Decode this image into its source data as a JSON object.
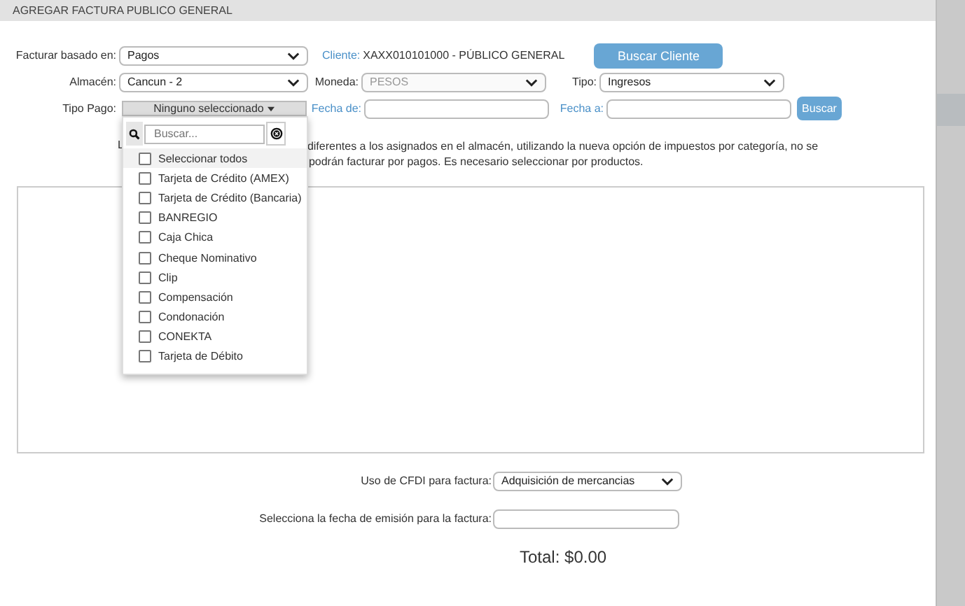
{
  "window": {
    "title": "AGREGAR FACTURA PUBLICO GENERAL"
  },
  "form": {
    "basado_label": "Facturar basado en:",
    "basado_value": "Pagos",
    "cliente_label": "Cliente:",
    "cliente_value": "XAXX010101000 - PÚBLICO GENERAL",
    "buscar_cliente": "Buscar Cliente",
    "almacen_label": "Almacén:",
    "almacen_value": "Cancun - 2",
    "moneda_label": "Moneda:",
    "moneda_value": "PESOS",
    "moneda_disabled": true,
    "tipo_label": "Tipo:",
    "tipo_value": "Ingresos",
    "tipo_pago_label": "Tipo Pago:",
    "tipo_pago_value": "Ninguno seleccionado",
    "fecha_de_label": "Fecha de:",
    "fecha_a_label": "Fecha a:",
    "buscar": "Buscar"
  },
  "note": {
    "lead": "L",
    "line_1": "diferentes a los asignados en el almacén, utilizando la nueva opción de impuestos por categoría, no se",
    "line_2": "podrán facturar por pagos. Es necesario seleccionar por productos."
  },
  "dropdown": {
    "expanded": true,
    "placeholder": "Buscar...",
    "options": [
      {
        "label": "Seleccionar todos",
        "checked": false,
        "highlighted": true
      },
      {
        "label": "Tarjeta de Crédito (AMEX)",
        "checked": false,
        "highlighted": false
      },
      {
        "label": "Tarjeta de Crédito (Bancaria)",
        "checked": false,
        "highlighted": false
      },
      {
        "label": "BANREGIO",
        "checked": false,
        "highlighted": false
      },
      {
        "label": "Caja Chica",
        "checked": false,
        "highlighted": false
      },
      {
        "label": "Cheque Nominativo",
        "checked": false,
        "highlighted": false
      },
      {
        "label": "Clip",
        "checked": false,
        "highlighted": false
      },
      {
        "label": "Compensación",
        "checked": false,
        "highlighted": false
      },
      {
        "label": "Condonación",
        "checked": false,
        "highlighted": false
      },
      {
        "label": "CONEKTA",
        "checked": false,
        "highlighted": false
      },
      {
        "label": "Tarjeta de Débito",
        "checked": false,
        "highlighted": false
      }
    ]
  },
  "footer": {
    "cfdi_label": "Uso de CFDI para factura:",
    "cfdi_value": "Adquisición de mercancias",
    "fecha_emision_label": "Selecciona la fecha de emisión para la factura:",
    "total": "Total: $0.00"
  }
}
